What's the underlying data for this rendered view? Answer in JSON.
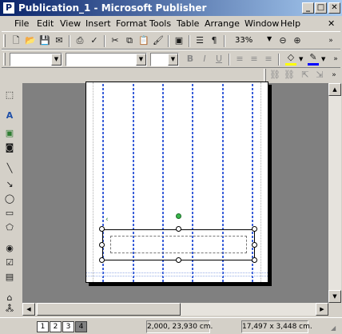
{
  "window": {
    "title": "Publication_1 - Microsoft Publisher",
    "icon": "publisher-icon",
    "controls": [
      "minimize",
      "maximize",
      "close"
    ]
  },
  "menu": [
    "File",
    "Edit",
    "View",
    "Insert",
    "Format",
    "Tools",
    "Table",
    "Arrange",
    "Window",
    "Help"
  ],
  "standard_toolbar": {
    "zoom": "33%",
    "icons": [
      "new-icon",
      "open-icon",
      "save-icon",
      "email-icon",
      "print-icon",
      "spelling-icon",
      "cut-icon",
      "copy-icon",
      "paste-icon",
      "format-painter-icon",
      "insert-picture-icon",
      "columns-icon",
      "show-formatting-icon",
      "zoom-out-icon",
      "zoom-in-icon"
    ]
  },
  "formatting_toolbar": {
    "style": "",
    "font": "",
    "font_size": "",
    "icons": [
      "bold-icon",
      "italic-icon",
      "underline-icon",
      "align-left-icon",
      "align-center-icon",
      "align-right-icon",
      "fill-color-icon",
      "line-color-icon"
    ]
  },
  "objects_toolbar": {
    "icons": [
      "select-objects-icon",
      "text-box-icon",
      "picture-frame-icon",
      "clip-art-icon",
      "line-icon",
      "arrow-icon",
      "oval-icon",
      "rectangle-icon",
      "autoshapes-icon",
      "hot-spot-icon",
      "form-control-icon",
      "design-gallery-icon",
      "insert-html-icon"
    ]
  },
  "status": {
    "pages": [
      "1",
      "2",
      "3",
      "4"
    ],
    "active_page": "4",
    "position": "2,000, 23,930 cm.",
    "size": "17,497 x 3,448 cm."
  },
  "colors": {
    "title_start": "#0a246a",
    "title_end": "#a6caf0",
    "guide": "#3a5fd9",
    "rotate_handle": "#39b54a"
  }
}
